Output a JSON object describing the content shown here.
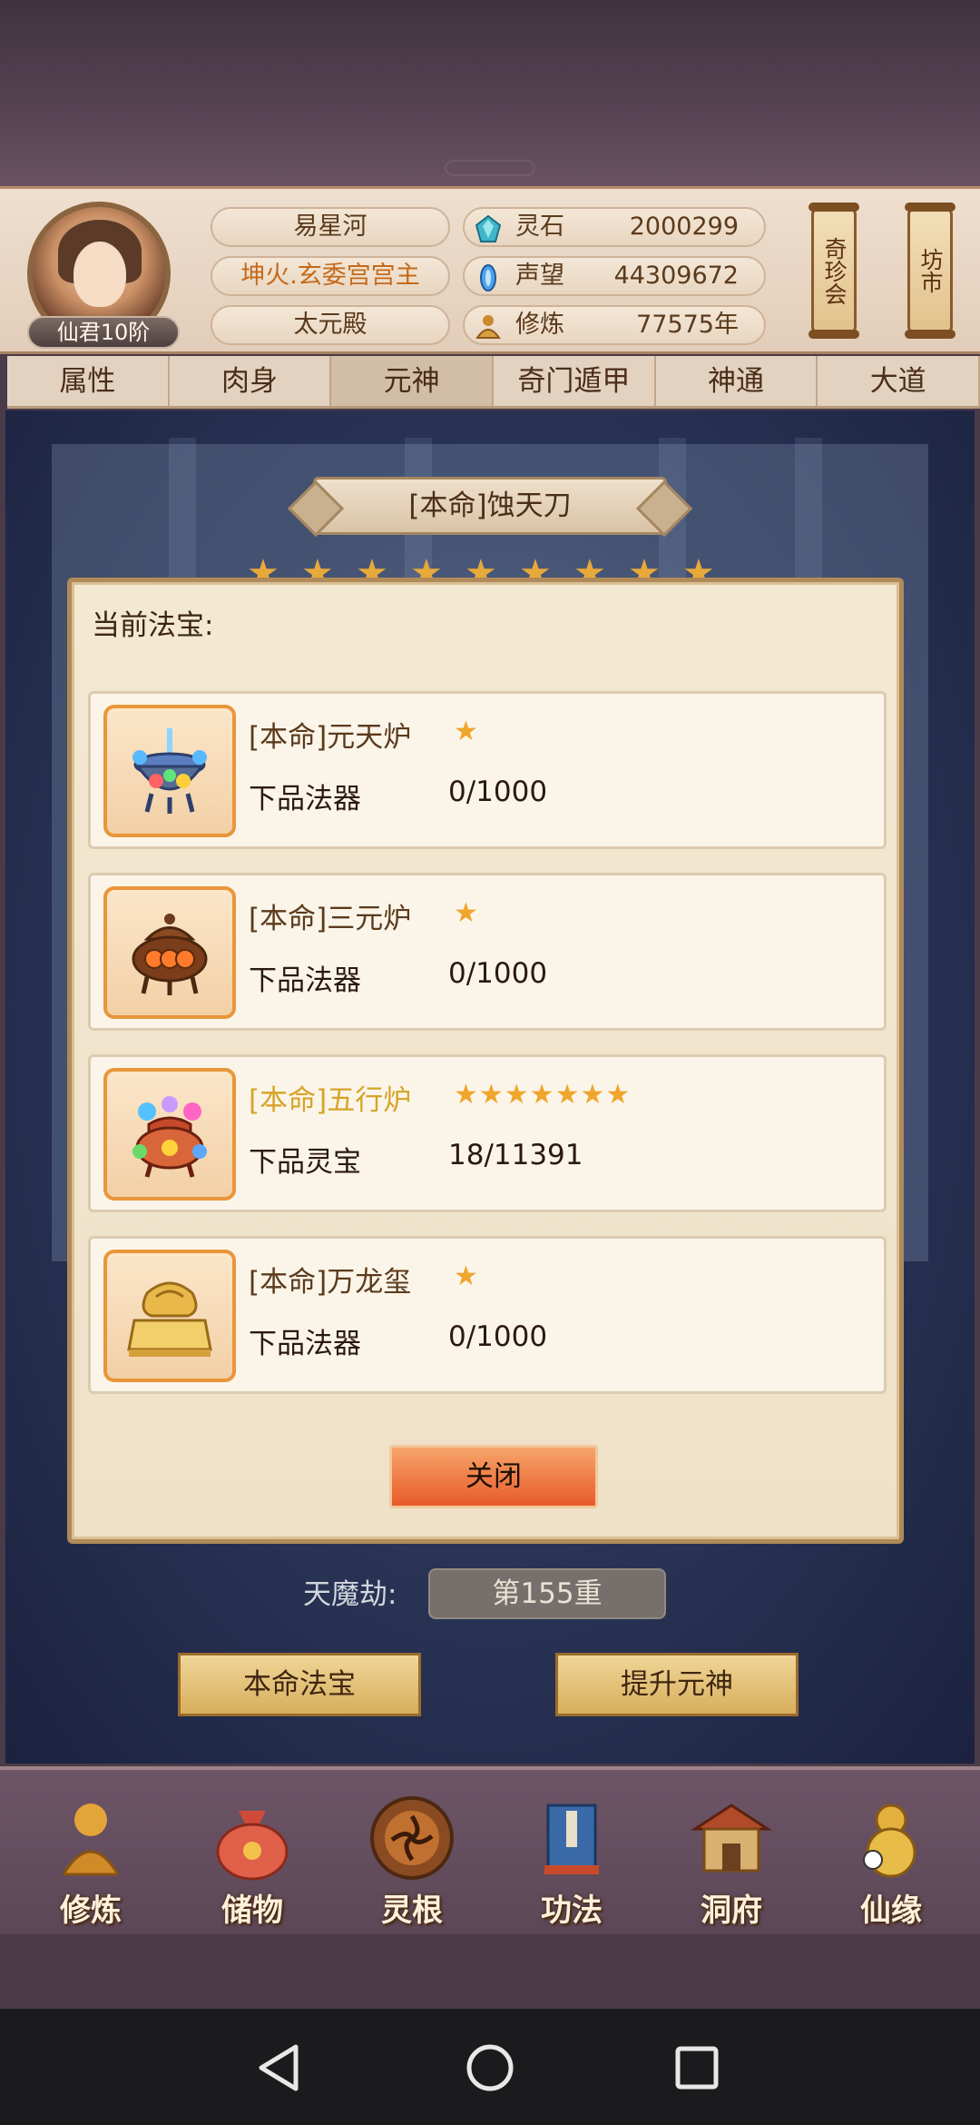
{
  "player": {
    "name": "易星河",
    "title": "坤火.玄委宫宫主",
    "sect": "太元殿",
    "rank": "仙君10阶"
  },
  "resources": [
    {
      "label": "灵石",
      "value": "2000299",
      "icon": "spirit-stone-icon"
    },
    {
      "label": "声望",
      "value": "44309672",
      "icon": "reputation-icon"
    },
    {
      "label": "修炼",
      "value": "77575年",
      "icon": "cultivation-icon"
    }
  ],
  "side_buttons": {
    "treasure": "奇珍会",
    "market": "坊市"
  },
  "tabs": [
    {
      "label": "属性",
      "active": false
    },
    {
      "label": "肉身",
      "active": false
    },
    {
      "label": "元神",
      "active": true
    },
    {
      "label": "奇门遁甲",
      "active": false
    },
    {
      "label": "神通",
      "active": false
    },
    {
      "label": "大道",
      "active": false
    }
  ],
  "scene": {
    "title": "[本命]蚀天刀",
    "tianmo_label": "天魔劫:",
    "tianmo_value": "第155重",
    "left_button": "本命法宝",
    "right_button": "提升元神"
  },
  "modal": {
    "title": "当前法宝:",
    "items": [
      {
        "name": "[本命]元天炉",
        "stars": "★",
        "grade": "下品法器",
        "progress": "0/1000",
        "highlight": false,
        "icon": "cauldron-icon"
      },
      {
        "name": "[本命]三元炉",
        "stars": "★",
        "grade": "下品法器",
        "progress": "0/1000",
        "highlight": false,
        "icon": "bronze-cauldron-icon"
      },
      {
        "name": "[本命]五行炉",
        "stars": "★★★★★★★",
        "grade": "下品灵宝",
        "progress": "18/11391",
        "highlight": true,
        "icon": "five-element-cauldron-icon"
      },
      {
        "name": "[本命]万龙玺",
        "stars": "★",
        "grade": "下品法器",
        "progress": "0/1000",
        "highlight": false,
        "icon": "dragon-seal-icon"
      }
    ],
    "close_label": "关闭"
  },
  "bottom_nav": [
    {
      "label": "修炼",
      "icon": "meditation-icon"
    },
    {
      "label": "储物",
      "icon": "storage-bag-icon"
    },
    {
      "label": "灵根",
      "icon": "spirit-root-icon"
    },
    {
      "label": "功法",
      "icon": "scripture-icon"
    },
    {
      "label": "洞府",
      "icon": "cave-mansion-icon"
    },
    {
      "label": "仙缘",
      "icon": "destiny-gourd-icon"
    }
  ],
  "colors": {
    "accent_gold": "#d6a427",
    "star": "#f0a52d",
    "close_button": "#e85a2b",
    "title_orange": "#c46a1c"
  }
}
